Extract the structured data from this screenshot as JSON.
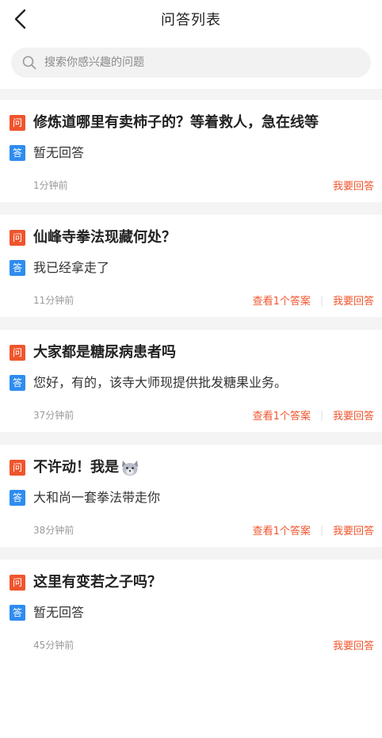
{
  "header": {
    "title": "问答列表",
    "back_icon": "chevron-left-icon"
  },
  "search": {
    "placeholder": "搜索你感兴趣的问题",
    "icon": "search-icon"
  },
  "tags": {
    "question": "问",
    "answer": "答"
  },
  "colors": {
    "question_tag": "#f0552d",
    "answer_tag": "#2e8cf0",
    "action_link": "#f0552d"
  },
  "items": [
    {
      "question": "修炼道哪里有卖柿子的？等着救人，急在线等",
      "answer": "暂无回答",
      "time": "1分钟前",
      "view_answers": "",
      "reply": "我要回答"
    },
    {
      "question": "仙峰寺拳法现藏何处？",
      "answer": "我已经拿走了",
      "time": "11分钟前",
      "view_answers": "查看1个答案",
      "reply": "我要回答"
    },
    {
      "question": "大家都是糖尿病患者吗",
      "answer": "您好，有的，该寺大师现提供批发糖果业务。",
      "time": "37分钟前",
      "view_answers": "查看1个答案",
      "reply": "我要回答"
    },
    {
      "question": "不许动！我是",
      "question_icon": "wolf-emoji-icon",
      "answer": "大和尚一套拳法带走你",
      "time": "38分钟前",
      "view_answers": "查看1个答案",
      "reply": "我要回答"
    },
    {
      "question": "这里有变若之子吗？",
      "answer": "暂无回答",
      "time": "45分钟前",
      "view_answers": "",
      "reply": "我要回答"
    }
  ]
}
